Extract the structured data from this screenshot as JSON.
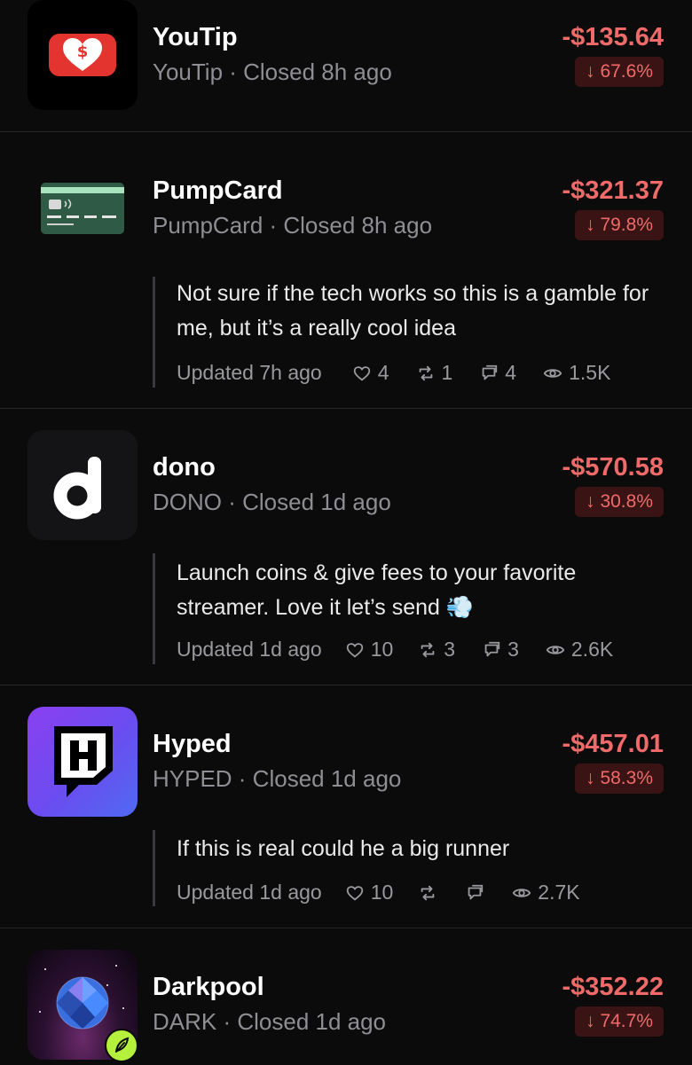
{
  "items": [
    {
      "name": "YouTip",
      "meta": "YouTip · Closed 8h ago",
      "amount": "-$135.64",
      "change": "↓ 67.6%",
      "logo_icon": "heart-dollar-icon"
    },
    {
      "name": "PumpCard",
      "meta": "PumpCard · Closed 8h ago",
      "amount": "-$321.37",
      "change": "↓ 79.8%",
      "logo_icon": "credit-card-icon",
      "comment": {
        "text": "Not sure if the tech works so this is a gamble for me, but it’s a really cool idea",
        "updated": "Updated 7h ago",
        "likes": "4",
        "reposts": "1",
        "replies": "4",
        "views": "1.5K"
      }
    },
    {
      "name": "dono",
      "meta": "DONO · Closed 1d ago",
      "amount": "-$570.58",
      "change": "↓ 30.8%",
      "logo_icon": "letter-d-icon",
      "comment": {
        "text": "Launch coins & give fees to your favorite streamer. Love it let’s send 💨",
        "updated": "Updated 1d ago",
        "likes": "10",
        "reposts": "3",
        "replies": "3",
        "views": "2.6K"
      }
    },
    {
      "name": "Hyped",
      "meta": "HYPED · Closed 1d ago",
      "amount": "-$457.01",
      "change": "↓ 58.3%",
      "logo_icon": "twitch-h-icon",
      "comment": {
        "text": "If this is real could he a big runner",
        "updated": "Updated 1d ago",
        "likes": "10",
        "reposts": "",
        "replies": "",
        "views": "2.7K"
      }
    },
    {
      "name": "Darkpool",
      "meta": "DARK · Closed 1d ago",
      "amount": "-$352.22",
      "change": "↓ 74.7%",
      "logo_icon": "planet-icon"
    }
  ],
  "colors": {
    "background": "#0b0b0c",
    "negative": "#f06a6a",
    "negative_badge_bg": "#3a1414",
    "muted": "#8e8e93"
  }
}
